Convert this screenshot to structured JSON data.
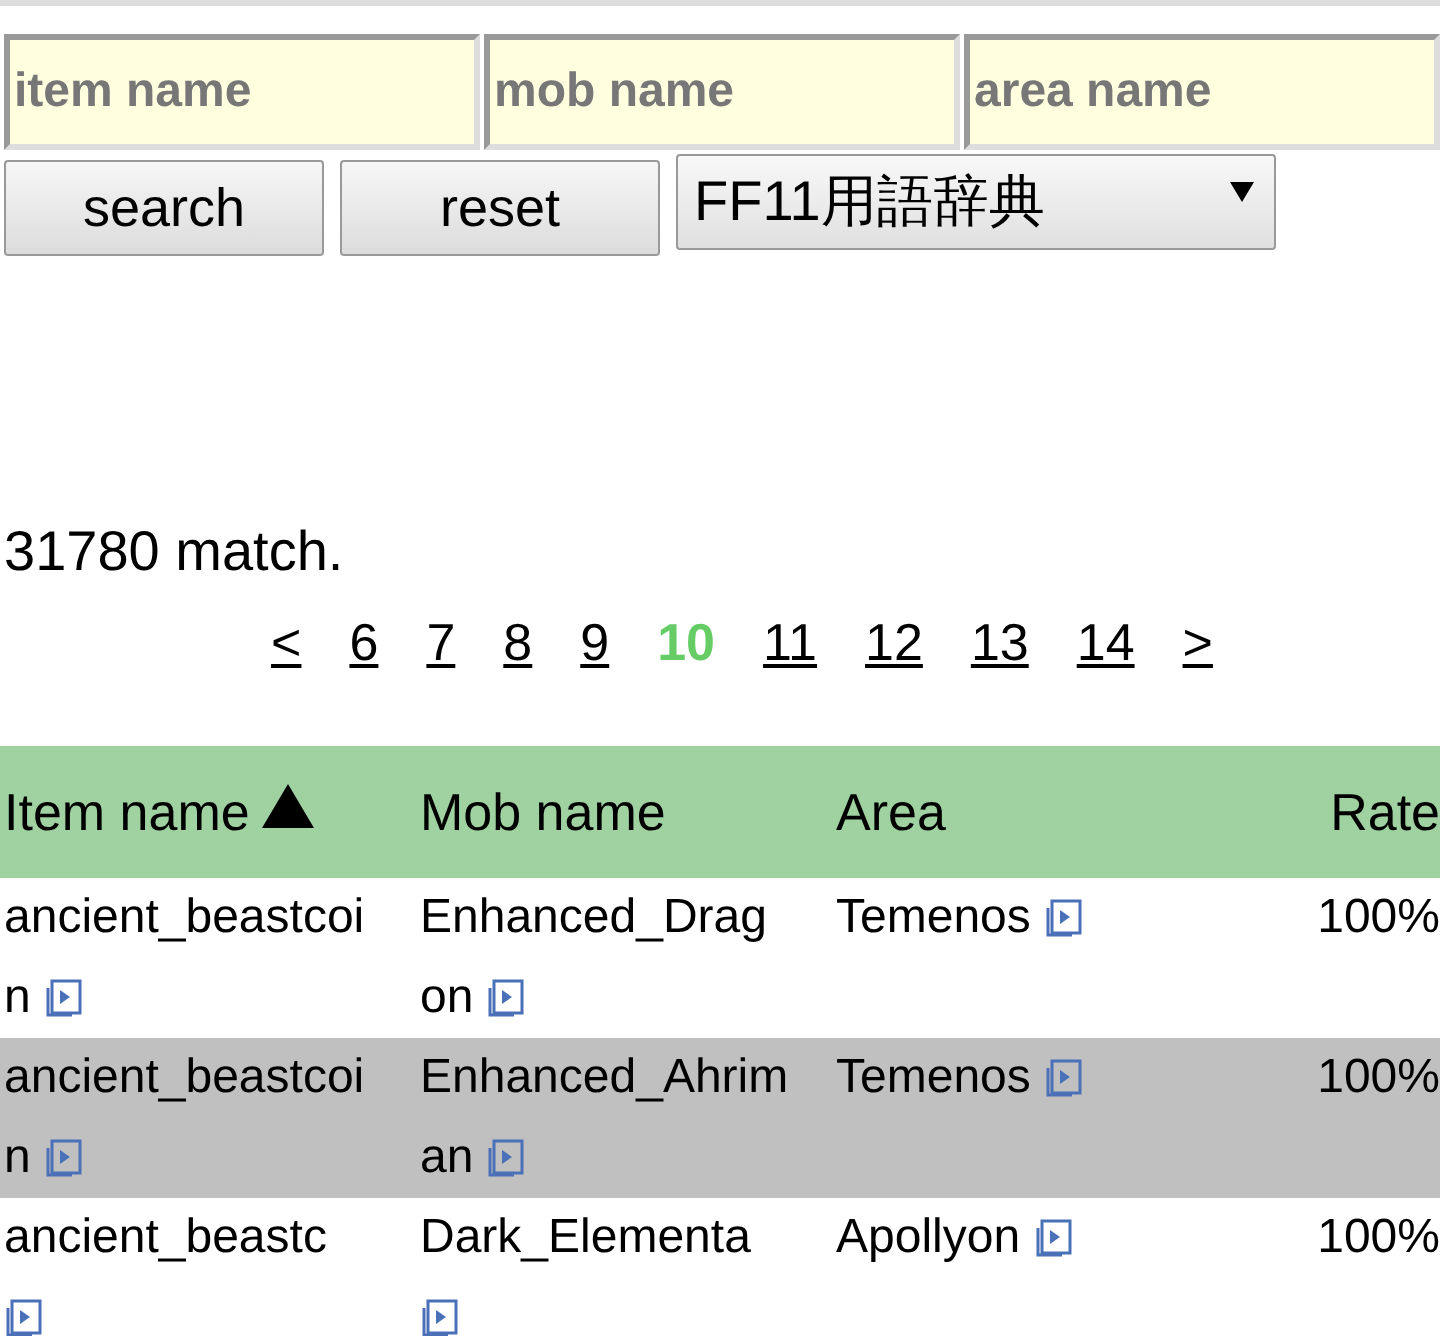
{
  "search_fields": [
    {
      "placeholder": "item name"
    },
    {
      "placeholder": "mob name"
    },
    {
      "placeholder": "area name"
    }
  ],
  "buttons": [
    "search",
    "reset"
  ],
  "dictionary_select": {
    "value": "FF11用語辞典"
  },
  "match_count": "31780 match.",
  "pagination": [
    {
      "label": "<",
      "selected": false
    },
    {
      "label": "6",
      "selected": false
    },
    {
      "label": "7",
      "selected": false
    },
    {
      "label": "8",
      "selected": false
    },
    {
      "label": "9",
      "selected": false
    },
    {
      "label": "10",
      "selected": true
    },
    {
      "label": "11",
      "selected": false
    },
    {
      "label": "12",
      "selected": false
    },
    {
      "label": "13",
      "selected": false
    },
    {
      "label": "14",
      "selected": false
    },
    {
      "label": ">",
      "selected": false
    }
  ],
  "table": {
    "columns": [
      {
        "label": "Item name",
        "sorted": true
      },
      {
        "label": "Mob name",
        "sorted": false
      },
      {
        "label": "Area",
        "sorted": false
      },
      {
        "label": "Rate",
        "sorted": false
      }
    ],
    "rows": [
      {
        "item": "ancient_beastcoin",
        "mob": "Enhanced_Dragon",
        "area": "Temenos",
        "rate": "100%"
      },
      {
        "item": "ancient_beastcoin",
        "mob": "Enhanced_Ahriman",
        "area": "Temenos",
        "rate": "100%"
      },
      {
        "item": "ancient_beastc",
        "mob": "Dark_Elementa",
        "area": "Apollyon",
        "rate": "100%"
      }
    ]
  }
}
